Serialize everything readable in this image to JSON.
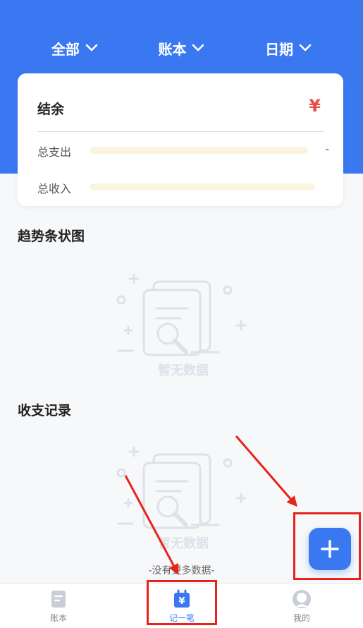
{
  "header": {
    "color": "#3a78f2",
    "filters": [
      {
        "label": "全部",
        "icon": "chevron-down-icon"
      },
      {
        "label": "账本",
        "icon": "chevron-down-icon"
      },
      {
        "label": "日期",
        "icon": "chevron-down-icon"
      }
    ]
  },
  "summary": {
    "balance_label": "结余",
    "currency_symbol": "¥",
    "currency_color": "#e94b4b",
    "expense_label": "总支出",
    "expense_value": "-",
    "income_label": "总收入"
  },
  "sections": {
    "trend_title": "趋势条状图",
    "records_title": "收支记录",
    "empty_text": "暂无数据",
    "no_more_text": "-没有更多数据-"
  },
  "fab": {
    "icon": "plus-icon"
  },
  "tabbar": {
    "active_color": "#3a78f2",
    "tabs": [
      {
        "label": "账本",
        "icon": "ledger-icon"
      },
      {
        "label": "记一笔",
        "icon": "calendar-yen-icon"
      },
      {
        "label": "我的",
        "icon": "profile-icon"
      }
    ]
  },
  "annotations": {
    "color": "#e8231b"
  }
}
